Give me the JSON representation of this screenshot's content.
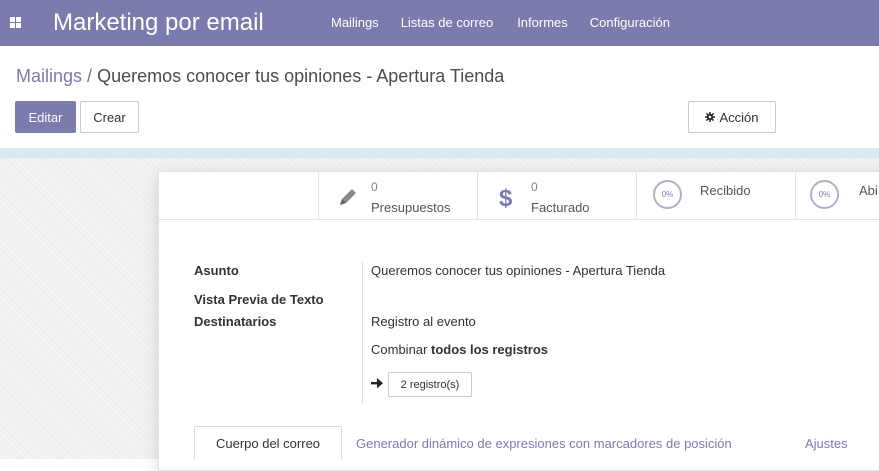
{
  "navbar": {
    "app_name": "Marketing por email",
    "menu": [
      "Mailings",
      "Listas de correo",
      "Informes",
      "Configuración"
    ]
  },
  "breadcrumb": {
    "parent": "Mailings",
    "separator": "/",
    "current": "Queremos conocer tus opiniones - Apertura Tienda"
  },
  "toolbar": {
    "edit_label": "Editar",
    "create_label": "Crear",
    "action_label": "Acción"
  },
  "stats": {
    "quotations": {
      "value": "0",
      "label": "Presupuestos"
    },
    "invoiced": {
      "value": "0",
      "label": "Facturado"
    },
    "received": {
      "percent": "0%",
      "label": "Recibido"
    },
    "opened": {
      "percent": "0%",
      "label": "Abi"
    }
  },
  "form": {
    "subject_label": "Asunto",
    "subject_value": "Queremos conocer tus opiniones - Apertura Tienda",
    "preview_label": "Vista Previa de Texto",
    "recipients_label": "Destinatarios",
    "recipients_value": "Registro al evento",
    "combine_prefix": "Combinar",
    "combine_bold": "todos los registros",
    "records_button": "2 registro(s)"
  },
  "tabs": [
    "Cuerpo del correo",
    "Generador dinámico de expresiones con marcadores de posición",
    "Ajustes"
  ],
  "colors": {
    "brand": "#7c7bad",
    "accent_strip": "#d9e9ef"
  }
}
